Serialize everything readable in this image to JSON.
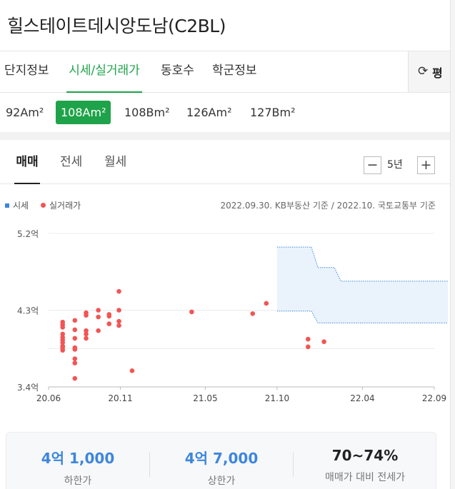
{
  "header": {
    "title": "힐스테이트데시앙도남(C2BL)"
  },
  "tabs": [
    {
      "label": "단지정보"
    },
    {
      "label": "시세/실거래가"
    },
    {
      "label": "동호수"
    },
    {
      "label": "학군정보"
    }
  ],
  "unit_toggle": {
    "label": "평",
    "icon": "refresh-icon"
  },
  "area_types": [
    "92Am²",
    "108Am²",
    "108Bm²",
    "126Am²",
    "127Bm²"
  ],
  "selected_area": "108Am²",
  "subtabs": [
    {
      "label": "매매"
    },
    {
      "label": "전세"
    },
    {
      "label": "월세"
    }
  ],
  "range": {
    "label": "5년",
    "minus": "−",
    "plus": "+"
  },
  "legend": {
    "items": [
      {
        "label": "시세",
        "color": "#3d86dc"
      },
      {
        "label": "실거래가",
        "color": "#f25555"
      }
    ],
    "note": "2022.09.30. KB부동산 기준 / 2022.10. 국토교통부 기준"
  },
  "chart_data": {
    "type": "scatter",
    "title": "",
    "xlabel": "",
    "ylabel": "",
    "x_ticks": [
      "20.06",
      "20.11",
      "21.05",
      "21.10",
      "22.04",
      "22.09"
    ],
    "y_ticks": [
      "3.4억",
      "4.3억",
      "5.2억"
    ],
    "ylim": [
      3.4,
      5.2
    ],
    "grid": true,
    "series": [
      {
        "name": "실거래가",
        "color": "#f25555",
        "points": [
          [
            "2020-07-01",
            4.16
          ],
          [
            "2020-07-01",
            4.13
          ],
          [
            "2020-07-01",
            4.1
          ],
          [
            "2020-07-01",
            4.02
          ],
          [
            "2020-07-01",
            3.98
          ],
          [
            "2020-07-01",
            3.95
          ],
          [
            "2020-07-01",
            3.92
          ],
          [
            "2020-07-01",
            3.88
          ],
          [
            "2020-07-01",
            3.86
          ],
          [
            "2020-07-01",
            3.83
          ],
          [
            "2020-07-27",
            4.18
          ],
          [
            "2020-07-27",
            4.07
          ],
          [
            "2020-07-27",
            3.97
          ],
          [
            "2020-07-27",
            3.86
          ],
          [
            "2020-07-27",
            3.84
          ],
          [
            "2020-07-27",
            3.73
          ],
          [
            "2020-07-27",
            3.68
          ],
          [
            "2020-07-27",
            3.5
          ],
          [
            "2020-08-20",
            4.27
          ],
          [
            "2020-08-20",
            4.24
          ],
          [
            "2020-08-20",
            4.06
          ],
          [
            "2020-08-20",
            4.02
          ],
          [
            "2020-08-20",
            3.97
          ],
          [
            "2020-09-15",
            4.3
          ],
          [
            "2020-09-15",
            4.22
          ],
          [
            "2020-09-15",
            4.06
          ],
          [
            "2020-10-08",
            4.25
          ],
          [
            "2020-10-08",
            4.23
          ],
          [
            "2020-10-08",
            4.14
          ],
          [
            "2020-10-29",
            4.52
          ],
          [
            "2020-10-29",
            4.3
          ],
          [
            "2020-10-29",
            4.17
          ],
          [
            "2020-10-29",
            4.12
          ],
          [
            "2020-11-26",
            3.59
          ],
          [
            "2021-04-02",
            4.28
          ],
          [
            "2021-08-10",
            4.26
          ],
          [
            "2021-09-08",
            4.38
          ],
          [
            "2021-12-06",
            3.96
          ],
          [
            "2021-12-06",
            3.87
          ],
          [
            "2022-01-09",
            3.93
          ]
        ]
      },
      {
        "name": "시세",
        "color": "#3d86dc",
        "type": "area",
        "upper": [
          [
            "2021-10-01",
            5.04
          ],
          [
            "2021-12-13",
            5.04
          ],
          [
            "2021-12-27",
            4.8
          ],
          [
            "2022-01-31",
            4.8
          ],
          [
            "2022-02-14",
            4.64
          ],
          [
            "2022-09-30",
            4.64
          ]
        ],
        "lower": [
          [
            "2021-10-01",
            4.29
          ],
          [
            "2021-12-13",
            4.29
          ],
          [
            "2021-12-27",
            4.15
          ],
          [
            "2022-09-30",
            4.15
          ]
        ]
      }
    ]
  },
  "summary": [
    {
      "value": "4억 1,000",
      "label": "하한가",
      "color": "#3d86dc"
    },
    {
      "value": "4억 7,000",
      "label": "상한가",
      "color": "#3d86dc"
    },
    {
      "value": "70~74%",
      "label": "매매가 대비 전세가",
      "color": "#222222"
    }
  ]
}
